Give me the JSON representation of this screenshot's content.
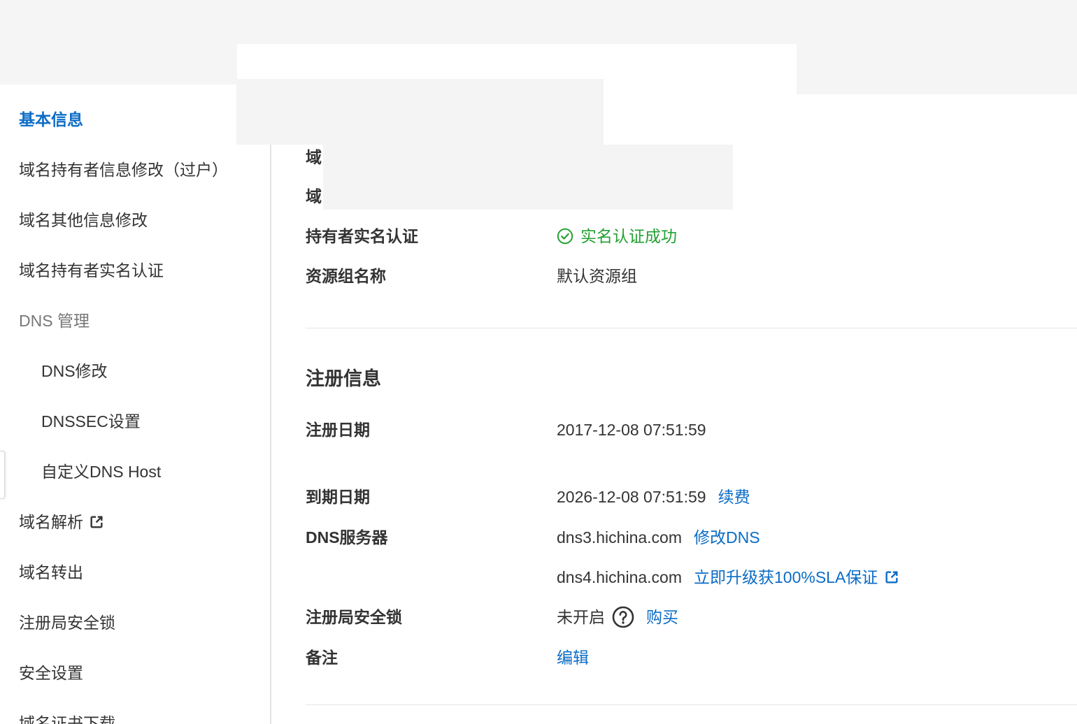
{
  "theme": {
    "link_color": "#0b6cc6",
    "success_color": "#23a032"
  },
  "sidebar": {
    "items": [
      {
        "label": "基本信息",
        "active": true
      },
      {
        "label": "域名持有者信息修改（过户）"
      },
      {
        "label": "域名其他信息修改"
      },
      {
        "label": "域名持有者实名认证"
      },
      {
        "label": "DNS 管理"
      },
      {
        "label": "DNS修改"
      },
      {
        "label": "DNSSEC设置"
      },
      {
        "label": "自定义DNS Host"
      },
      {
        "label": "域名解析",
        "icon": "external-link-icon"
      },
      {
        "label": "域名转出"
      },
      {
        "label": "注册局安全锁"
      },
      {
        "label": "安全设置"
      },
      {
        "label": "域名证书下载"
      }
    ]
  },
  "basic_info": {
    "rows": [
      {
        "label": "域"
      },
      {
        "label": "域"
      },
      {
        "label": "持有者实名认证",
        "value": "实名认证成功",
        "icon": "check-circle-icon"
      },
      {
        "label": "资源组名称",
        "value": "默认资源组"
      }
    ]
  },
  "registration": {
    "title": "注册信息",
    "registration_date": {
      "label": "注册日期",
      "value": "2017-12-08 07:51:59"
    },
    "expiry_date": {
      "label": "到期日期",
      "value": "2026-12-08 07:51:59",
      "action": "续费"
    },
    "dns_servers": {
      "label": "DNS服务器",
      "servers": [
        {
          "value": "dns3.hichina.com",
          "action": "修改DNS"
        },
        {
          "value": "dns4.hichina.com",
          "action": "立即升级获100%SLA保证",
          "icon": "external-link-icon"
        }
      ]
    },
    "registry_lock": {
      "label": "注册局安全锁",
      "value": "未开启",
      "icon": "help-circle-icon",
      "action": "购买"
    },
    "remark": {
      "label": "备注",
      "action": "编辑"
    }
  }
}
